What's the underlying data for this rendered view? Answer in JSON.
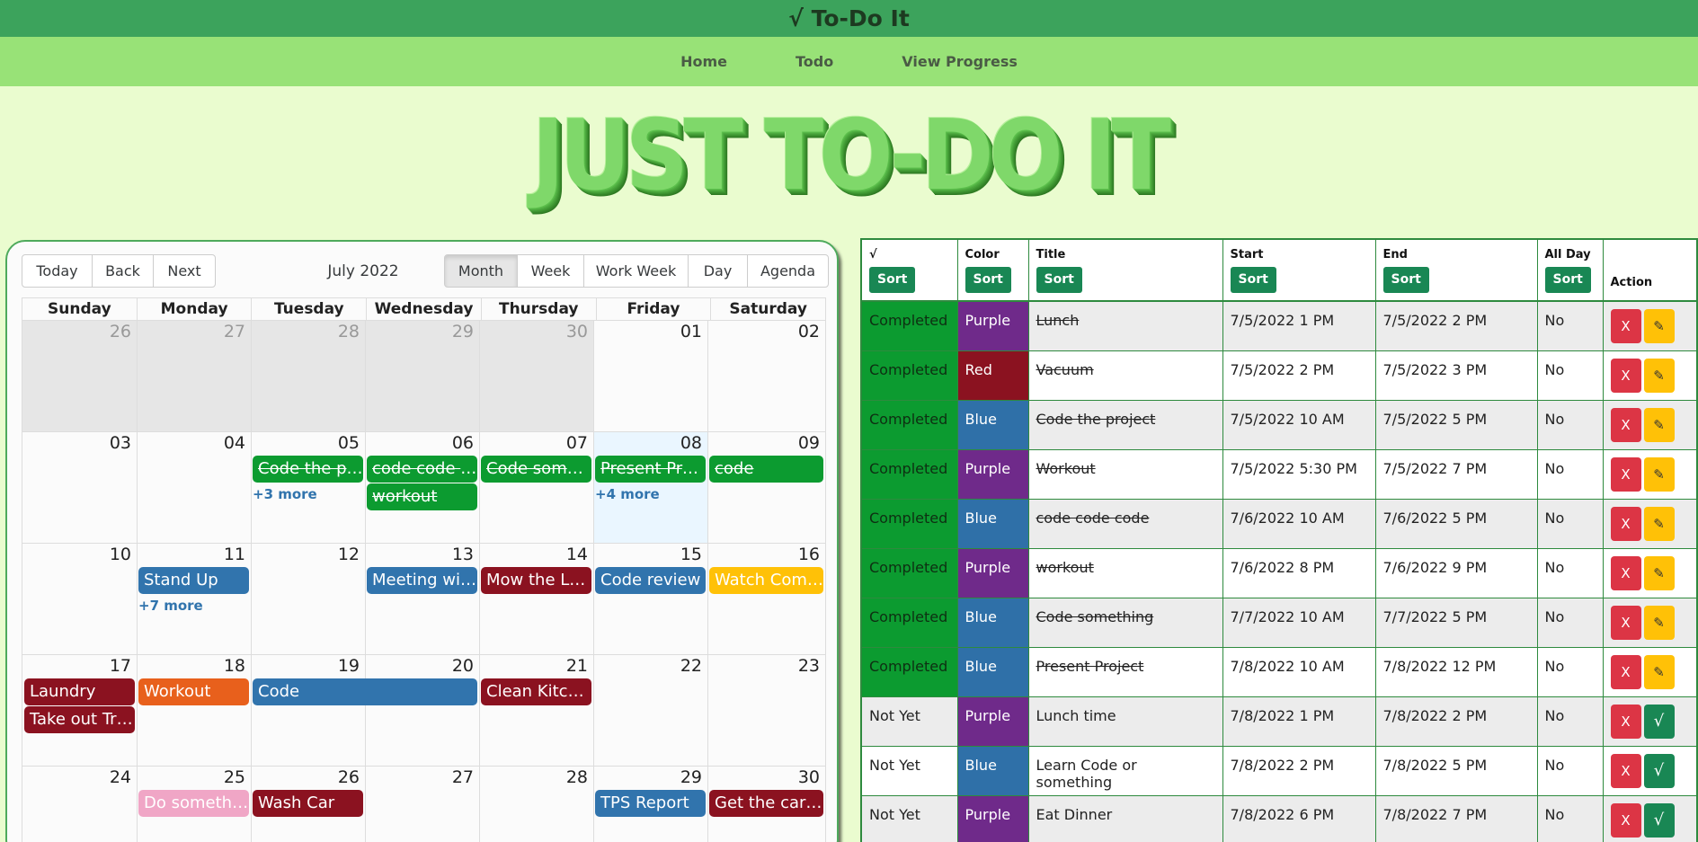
{
  "app": {
    "brand": "√ To-Do It"
  },
  "nav": [
    {
      "label": "Home"
    },
    {
      "label": "Todo"
    },
    {
      "label": "View Progress"
    }
  ],
  "hero": {
    "title": "JUST TO-DO IT"
  },
  "calendar": {
    "nav_buttons": [
      "Today",
      "Back",
      "Next"
    ],
    "label": "July 2022",
    "views": [
      "Month",
      "Week",
      "Work Week",
      "Day",
      "Agenda"
    ],
    "active_view": "Month",
    "day_names": [
      "Sunday",
      "Monday",
      "Tuesday",
      "Wednesday",
      "Thursday",
      "Friday",
      "Saturday"
    ],
    "weeks": [
      {
        "dates": [
          "26",
          "27",
          "28",
          "29",
          "30",
          "01",
          "02"
        ],
        "off": [
          0,
          1,
          2,
          3,
          4
        ],
        "events": [],
        "more": []
      },
      {
        "dates": [
          "03",
          "04",
          "05",
          "06",
          "07",
          "08",
          "09"
        ],
        "off": [],
        "today": 5,
        "events": [
          {
            "title": "Code the project",
            "start": 2,
            "span": 1,
            "row": 0,
            "color": "#0c9b30",
            "done": true
          },
          {
            "title": "code code code",
            "start": 3,
            "span": 1,
            "row": 0,
            "color": "#0c9b30",
            "done": true
          },
          {
            "title": "Code something",
            "start": 4,
            "span": 1,
            "row": 0,
            "color": "#0c9b30",
            "done": true
          },
          {
            "title": "Present Project",
            "start": 5,
            "span": 1,
            "row": 0,
            "color": "#0c9b30",
            "done": true
          },
          {
            "title": "code",
            "start": 6,
            "span": 1,
            "row": 0,
            "color": "#0c9b30",
            "done": true
          },
          {
            "title": "workout",
            "start": 3,
            "span": 1,
            "row": 1,
            "color": "#0c9b30",
            "done": true
          }
        ],
        "more": [
          {
            "col": 2,
            "label": "+3 more"
          },
          {
            "col": 5,
            "label": "+4 more"
          }
        ]
      },
      {
        "dates": [
          "10",
          "11",
          "12",
          "13",
          "14",
          "15",
          "16"
        ],
        "off": [],
        "events": [
          {
            "title": "Stand Up",
            "start": 1,
            "span": 1,
            "row": 0,
            "color": "#3174ad",
            "done": false
          },
          {
            "title": "Meeting with team",
            "start": 3,
            "span": 1,
            "row": 0,
            "color": "#3174ad",
            "done": false
          },
          {
            "title": "Mow the Lawn",
            "start": 4,
            "span": 1,
            "row": 0,
            "color": "#8b1220",
            "done": false
          },
          {
            "title": "Code review",
            "start": 5,
            "span": 1,
            "row": 0,
            "color": "#3174ad",
            "done": false
          },
          {
            "title": "Watch Comedy",
            "start": 6,
            "span": 1,
            "row": 0,
            "color": "#ffc107",
            "done": false
          }
        ],
        "more": [
          {
            "col": 1,
            "label": "+7 more"
          }
        ]
      },
      {
        "dates": [
          "17",
          "18",
          "19",
          "20",
          "21",
          "22",
          "23"
        ],
        "off": [],
        "events": [
          {
            "title": "Laundry",
            "start": 0,
            "span": 1,
            "row": 0,
            "color": "#8b1220",
            "done": false
          },
          {
            "title": "Workout",
            "start": 1,
            "span": 1,
            "row": 0,
            "color": "#e8601c",
            "done": false
          },
          {
            "title": "Code",
            "start": 2,
            "span": 2,
            "row": 0,
            "color": "#3174ad",
            "done": false
          },
          {
            "title": "Clean Kitchen",
            "start": 4,
            "span": 1,
            "row": 0,
            "color": "#8b1220",
            "done": false
          },
          {
            "title": "Take out Trash",
            "start": 0,
            "span": 1,
            "row": 1,
            "color": "#8b1220",
            "done": false
          }
        ],
        "more": []
      },
      {
        "dates": [
          "24",
          "25",
          "26",
          "27",
          "28",
          "29",
          "30"
        ],
        "off": [],
        "events": [
          {
            "title": "Do something",
            "start": 1,
            "span": 1,
            "row": 0,
            "color": "#f0a6c6",
            "done": false
          },
          {
            "title": "Wash Car",
            "start": 2,
            "span": 1,
            "row": 0,
            "color": "#8b1220",
            "done": false
          },
          {
            "title": "TPS Report",
            "start": 5,
            "span": 1,
            "row": 0,
            "color": "#3174ad",
            "done": false
          },
          {
            "title": "Get the car washed",
            "start": 6,
            "span": 1,
            "row": 0,
            "color": "#8b1220",
            "done": false
          }
        ],
        "more": []
      }
    ]
  },
  "table": {
    "columns": [
      {
        "label": "√",
        "sort": "Sort"
      },
      {
        "label": "Color",
        "sort": "Sort"
      },
      {
        "label": "Title",
        "sort": "Sort"
      },
      {
        "label": "Start",
        "sort": "Sort"
      },
      {
        "label": "End",
        "sort": "Sort"
      },
      {
        "label": "All Day",
        "sort": "Sort"
      },
      {
        "label": "Action",
        "sort": ""
      }
    ],
    "colors": {
      "Purple": "#6f2a8a",
      "Red": "#8b1220",
      "Blue": "#2f70a8"
    },
    "delete_label": "X",
    "edit_label": "✎",
    "done_label": "√",
    "rows": [
      {
        "status": "Completed",
        "color": "Purple",
        "title": "Lunch",
        "start": "7/5/2022 1 PM",
        "end": "7/5/2022 2 PM",
        "all_day": "No"
      },
      {
        "status": "Completed",
        "color": "Red",
        "title": "Vacuum",
        "start": "7/5/2022 2 PM",
        "end": "7/5/2022 3 PM",
        "all_day": "No"
      },
      {
        "status": "Completed",
        "color": "Blue",
        "title": "Code the project",
        "start": "7/5/2022 10 AM",
        "end": "7/5/2022 5 PM",
        "all_day": "No"
      },
      {
        "status": "Completed",
        "color": "Purple",
        "title": "Workout",
        "start": "7/5/2022 5:30 PM",
        "end": "7/5/2022 7 PM",
        "all_day": "No"
      },
      {
        "status": "Completed",
        "color": "Blue",
        "title": "code code code",
        "start": "7/6/2022 10 AM",
        "end": "7/6/2022 5 PM",
        "all_day": "No"
      },
      {
        "status": "Completed",
        "color": "Purple",
        "title": "workout",
        "start": "7/6/2022 8 PM",
        "end": "7/6/2022 9 PM",
        "all_day": "No"
      },
      {
        "status": "Completed",
        "color": "Blue",
        "title": "Code something",
        "start": "7/7/2022 10 AM",
        "end": "7/7/2022 5 PM",
        "all_day": "No"
      },
      {
        "status": "Completed",
        "color": "Blue",
        "title": "Present Project",
        "start": "7/8/2022 10 AM",
        "end": "7/8/2022 12 PM",
        "all_day": "No"
      },
      {
        "status": "Not Yet",
        "color": "Purple",
        "title": "Lunch time",
        "start": "7/8/2022 1 PM",
        "end": "7/8/2022 2 PM",
        "all_day": "No"
      },
      {
        "status": "Not Yet",
        "color": "Blue",
        "title": "Learn Code or something",
        "start": "7/8/2022 2 PM",
        "end": "7/8/2022 5 PM",
        "all_day": "No"
      },
      {
        "status": "Not Yet",
        "color": "Purple",
        "title": "Eat Dinner",
        "start": "7/8/2022 6 PM",
        "end": "7/8/2022 7 PM",
        "all_day": "No"
      }
    ]
  }
}
